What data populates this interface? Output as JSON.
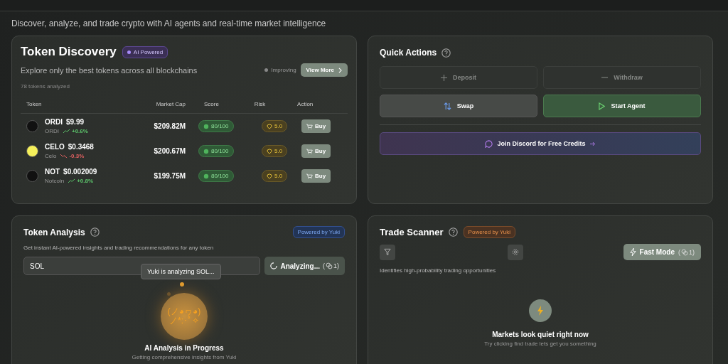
{
  "subtitle": "Discover, analyze, and trade crypto with AI agents and real-time market intelligence",
  "discovery": {
    "title": "Token Discovery",
    "badge": "AI Powered",
    "description": "Explore only the best tokens across all blockchains",
    "count": "78 tokens analyzed",
    "status": "Improving",
    "view_more": "View More",
    "columns": [
      "Token",
      "Market Cap",
      "Score",
      "Risk",
      "Action"
    ],
    "rows": [
      {
        "symbol": "ORDI",
        "price": "$9.99",
        "name": "ORDI",
        "change": "+0.6%",
        "kind": "up",
        "color": "#111111",
        "market_cap": "$209.82M",
        "score": "80/100",
        "risk": "5.0",
        "action": "Buy"
      },
      {
        "symbol": "CELO",
        "price": "$0.3468",
        "name": "Celo",
        "change": "-0.3%",
        "kind": "down",
        "color": "#f5f05a",
        "market_cap": "$200.67M",
        "score": "80/100",
        "risk": "5.0",
        "action": "Buy"
      },
      {
        "symbol": "NOT",
        "price": "$0.002009",
        "name": "Notcoin",
        "change": "+0.8%",
        "kind": "up",
        "color": "#111111",
        "market_cap": "$199.75M",
        "score": "80/100",
        "risk": "5.0",
        "action": "Buy"
      }
    ]
  },
  "quick_actions": {
    "title": "Quick Actions",
    "buttons": [
      {
        "label": "Deposit",
        "kind": "plus",
        "disabled": true
      },
      {
        "label": "Withdraw",
        "kind": "minus",
        "disabled": true
      },
      {
        "label": "Swap",
        "kind": "swap",
        "disabled": false
      },
      {
        "label": "Start Agent",
        "kind": "play",
        "disabled": false
      }
    ],
    "discord": "Join Discord for Free Credits"
  },
  "analysis": {
    "title": "Token Analysis",
    "badge": "Powered by Yuki",
    "description": "Get instant AI-powered insights and trading recommendations for any token",
    "input_value": "SOL",
    "button": "Analyzing...",
    "loading": true,
    "cost": [
      "(",
      "1)"
    ],
    "tooltip": "Yuki is analyzing SOL...",
    "face_lines": [
      "(ノ◕ヮ◕)",
      "ノ*:･ﾟ✧"
    ],
    "progress_title": "AI Analysis in Progress",
    "progress_text": "Getting comprehensive insights from Yuki"
  },
  "scanner": {
    "title": "Trade Scanner",
    "badge": "Powered by Yuki",
    "fast_mode": "Fast Mode",
    "cost": [
      "(",
      "1)"
    ],
    "description": "Identifies high-probability trading opportunities",
    "empty_title": "Markets look quiet right now",
    "empty_text": "Try clicking find trade lets get you something"
  }
}
